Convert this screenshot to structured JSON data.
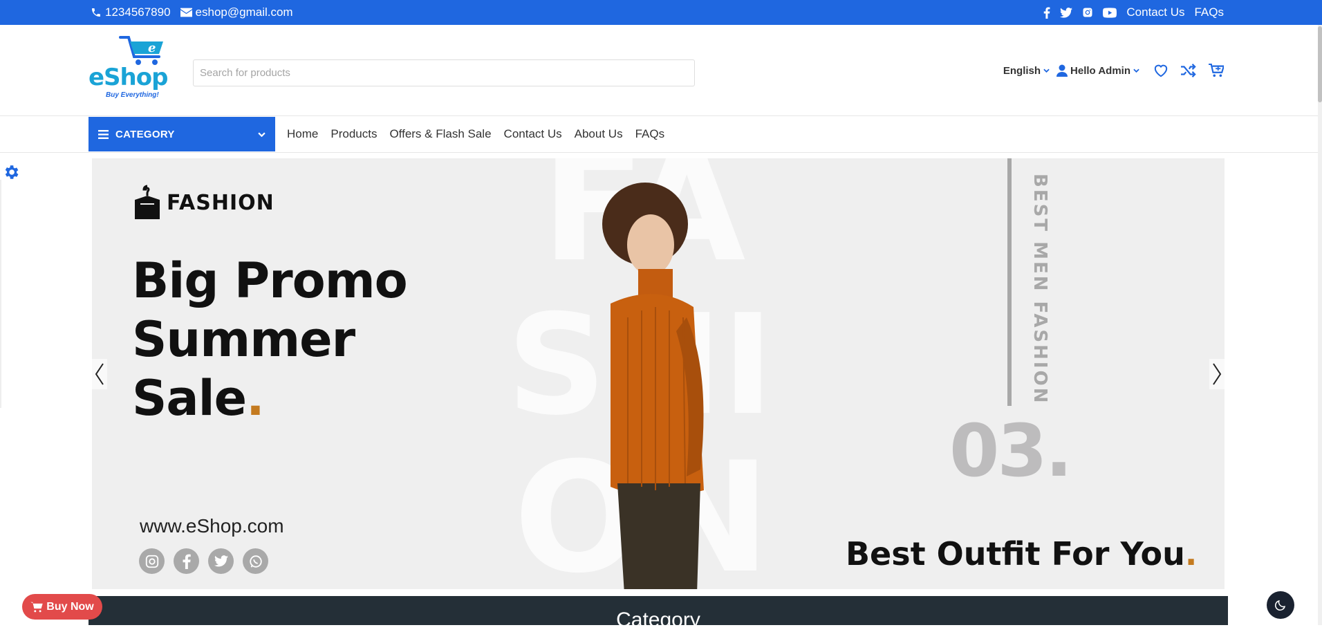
{
  "topbar": {
    "phone": "1234567890",
    "email": "eshop@gmail.com",
    "links": [
      "Contact Us",
      "FAQs"
    ],
    "social_icons": [
      "facebook-icon",
      "twitter-icon",
      "instagram-icon",
      "youtube-icon"
    ]
  },
  "header": {
    "logo_text": "eShop",
    "logo_tagline": "Buy Everything!",
    "search_placeholder": "Search for products",
    "language": "English",
    "user_greeting": "Hello Admin"
  },
  "nav": {
    "category_label": "CATEGORY",
    "links": [
      "Home",
      "Products",
      "Offers & Flash Sale",
      "Contact Us",
      "About Us",
      "FAQs"
    ]
  },
  "hero": {
    "brand": "FASHION",
    "headline_lines": [
      "Big Promo",
      "Summer",
      "Sale"
    ],
    "headline_dot": ".",
    "website": "www.eShop.com",
    "vertical_text": "BEST MEN FASHION",
    "slide_number": "03.",
    "tagline": "Best Outfit For You",
    "tagline_dot": ".",
    "background_letters": "FASHION",
    "accent_color": "#c47a1f"
  },
  "category_section": {
    "title": "Category"
  },
  "floating": {
    "buy_now": "Buy Now"
  },
  "colors": {
    "primary": "#1f67e0",
    "dark": "#242f37",
    "buy_now": "#e24a4a"
  }
}
